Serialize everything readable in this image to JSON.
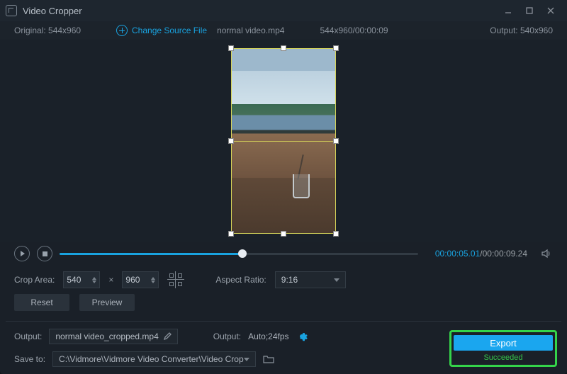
{
  "titlebar": {
    "title": "Video Cropper"
  },
  "infobar": {
    "original_label": "Original:",
    "original_value": "544x960",
    "change_source_label": "Change Source File",
    "filename": "normal video.mp4",
    "source_info": "544x960/00:00:09",
    "output_label": "Output:",
    "output_value": "540x960"
  },
  "transport": {
    "position_pct": 51,
    "current_time": "00:00:05.01",
    "total_time": "00:00:09.24"
  },
  "crop": {
    "label": "Crop Area:",
    "width": "540",
    "height": "960",
    "aspect_label": "Aspect Ratio:",
    "aspect_value": "9:16"
  },
  "buttons": {
    "reset": "Reset",
    "preview": "Preview",
    "export": "Export"
  },
  "output_panel": {
    "output_label": "Output:",
    "output_filename": "normal video_cropped.mp4",
    "format_label": "Output:",
    "format_value": "Auto;24fps",
    "save_to_label": "Save to:",
    "save_to_path": "C:\\Vidmore\\Vidmore Video Converter\\Video Crop",
    "status": "Succeeded"
  }
}
